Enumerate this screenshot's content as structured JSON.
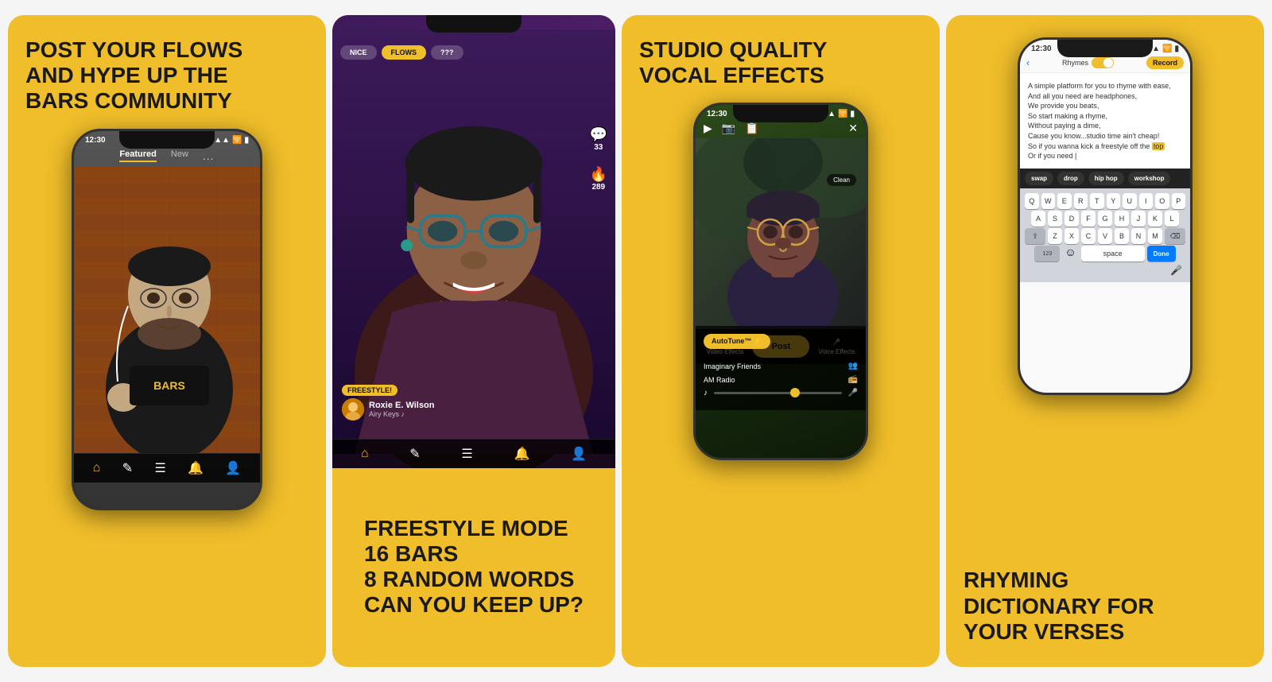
{
  "page": {
    "title": "Phone Screenshots"
  },
  "cards": [
    {
      "id": "card1",
      "title": "POST YOUR FLOWS\nAND HYPE UP THE\nBARSCOMMUNITY",
      "title_line1": "POST YOUR FLOWS",
      "title_line2": "AND HYPE UP THE",
      "title_line3": "BARS COMMUNITY",
      "phone": {
        "time": "12:30",
        "nav_featured": "Featured",
        "nav_new": "New",
        "dots": "..."
      }
    },
    {
      "id": "card2",
      "title_line1": "FREESTYLE MODE",
      "title_line2": "16 BARS",
      "title_line3": "8 RANDOM WORDS",
      "title_line4": "CAN YOU KEEP UP?",
      "phone": {
        "badge": "FREESTYLE!",
        "username": "Roxie E. Wilson",
        "subtitle": "Airy Keys",
        "comment_count": "33",
        "fire_count": "289",
        "tab1": "NICE",
        "tab2": "FLOWS",
        "tab3": "???"
      }
    },
    {
      "id": "card3",
      "title": "STUDIO QUALITY\nVOCAL EFFECTS",
      "title_line1": "STUDIO QUALITY",
      "title_line2": "VOCAL EFFECTS",
      "phone": {
        "time": "12:30",
        "autotune": "AutoTune™ ⚡",
        "effect1": "Imaginary Friends",
        "effect2": "AM Radio",
        "post_label": "Post",
        "video_effects": "Video Effects",
        "voice_effects": "Voice Effects",
        "clean_label": "Clean"
      }
    },
    {
      "id": "card4",
      "title_line1": "RHYMING",
      "title_line2": "DICTIONARY FOR",
      "title_line3": "YOUR VERSES",
      "phone": {
        "time": "12:30",
        "rhymes_label": "Rhymes",
        "record_label": "Record",
        "lyric_text": "A simple platform for you to rhyme with ease,\nAnd all you need are headphones,\nWe provide you beats,\nSo start making a rhyme,\nWithout paying a dime,\nCause you know...studio time ain't cheap!\nSo if you wanna kick a freestyle off the top\nOr if you need |",
        "tag1": "swap",
        "tag2": "drop",
        "tag3": "hip hop",
        "tag4": "workshop",
        "keys_row1": [
          "Q",
          "W",
          "E",
          "R",
          "T",
          "Y",
          "U",
          "I",
          "O",
          "P"
        ],
        "keys_row2": [
          "A",
          "S",
          "D",
          "F",
          "G",
          "H",
          "J",
          "K",
          "L"
        ],
        "keys_row3": [
          "Z",
          "X",
          "C",
          "V",
          "B",
          "N",
          "M"
        ],
        "num_label": "123",
        "space_label": "space",
        "done_label": "Done"
      }
    }
  ]
}
